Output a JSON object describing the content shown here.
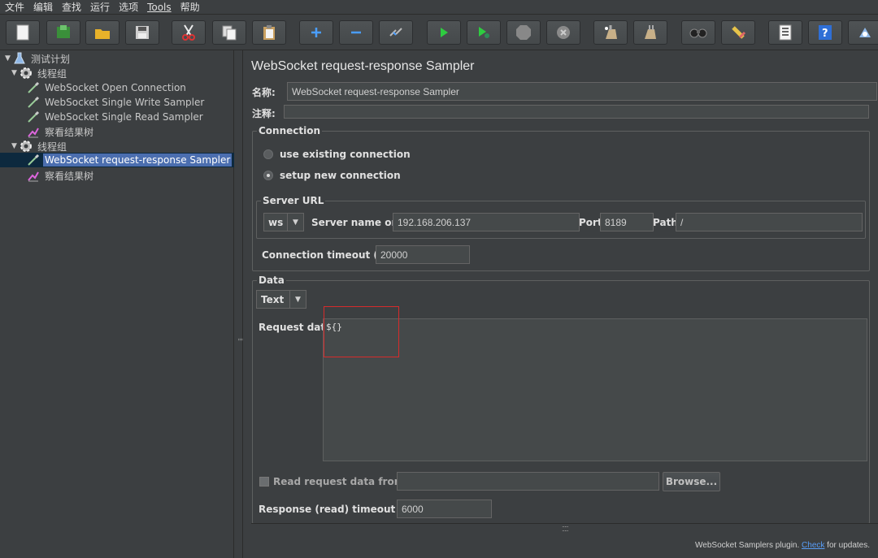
{
  "menu": {
    "items": [
      {
        "label": "文件"
      },
      {
        "label": "编辑"
      },
      {
        "label": "查找"
      },
      {
        "label": "运行"
      },
      {
        "label": "选项"
      },
      {
        "label": "Tools"
      },
      {
        "label": "帮助"
      }
    ]
  },
  "toolbar": {
    "buttons": [
      {
        "icon": "new-icon"
      },
      {
        "icon": "templates-icon"
      },
      {
        "icon": "open-icon"
      },
      {
        "icon": "save-icon"
      },
      {
        "icon": "cut-icon"
      },
      {
        "icon": "copy-icon"
      },
      {
        "icon": "paste-icon"
      },
      {
        "icon": "expand-icon"
      },
      {
        "icon": "collapse-icon"
      },
      {
        "icon": "toggle-icon"
      },
      {
        "icon": "start-icon"
      },
      {
        "icon": "start-no-pauses-icon"
      },
      {
        "icon": "stop-icon"
      },
      {
        "icon": "shutdown-icon"
      },
      {
        "icon": "clear-icon"
      },
      {
        "icon": "clear-all-icon"
      },
      {
        "icon": "search-icon"
      },
      {
        "icon": "reset-search-icon"
      },
      {
        "icon": "function-helper-icon"
      },
      {
        "icon": "help-icon"
      },
      {
        "icon": "remote-icon"
      }
    ]
  },
  "tree": {
    "plan": "测试计划",
    "group1": "线程组",
    "open_conn": "WebSocket Open Connection",
    "single_write": "WebSocket Single Write Sampler",
    "single_read": "WebSocket Single Read Sampler",
    "results1": "察看结果树",
    "group2": "线程组",
    "req_resp": "WebSocket request-response Sampler",
    "results2": "察看结果树"
  },
  "panel": {
    "title": "WebSocket request-response Sampler",
    "name_label": "名称:",
    "name_value": "WebSocket request-response Sampler",
    "comment_label": "注释:",
    "comment_value": "",
    "connection_legend": "Connection",
    "radio_existing": "use existing connection",
    "radio_new": "setup new connection",
    "server_url_legend": "Server URL",
    "protocol": "ws",
    "server_label": "Server name or IP:",
    "server_value": "192.168.206.137",
    "port_label": "Port:",
    "port_value": "8189",
    "path_label": "Path:",
    "path_value": "/",
    "conn_timeout_label": "Connection timeout (ms):",
    "conn_timeout_value": "20000",
    "data_legend": "Data",
    "data_type": "Text",
    "request_data_label": "Request data:",
    "request_data_value": "${}",
    "read_file_label": "Read request data from file:",
    "read_file_value": "",
    "browse_label": "Browse...",
    "resp_timeout_label": "Response (read) timeout (ms):",
    "resp_timeout_value": "6000",
    "footer_text": "WebSocket Samplers plugin. ",
    "footer_link": "Check",
    "footer_tail": " for updates."
  },
  "colors": {
    "background": "#3c3f41",
    "selection": "#4b6eaf",
    "highlight_box": "#d62b2b",
    "link": "#589df6"
  }
}
